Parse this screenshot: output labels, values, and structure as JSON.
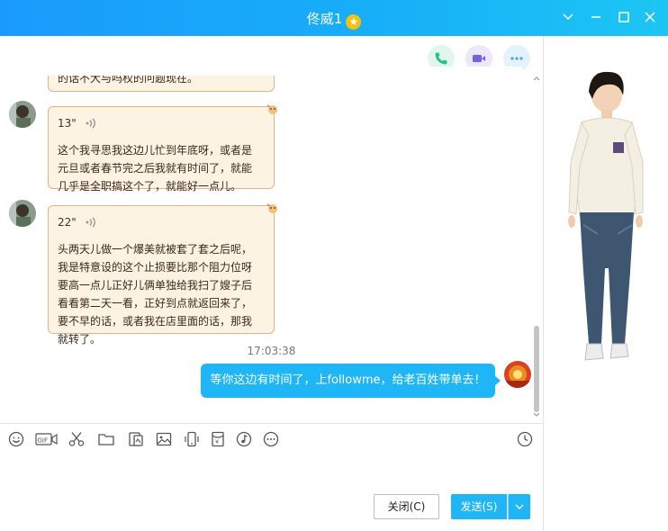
{
  "window": {
    "title": "佟威1",
    "title_badge": "★"
  },
  "chat": {
    "partial_message": "的话不大与吗权的问题现在。",
    "messages": [
      {
        "voice_duration": "13\"",
        "text": [
          "这个我寻思我这边儿忙到年底呀，或者是",
          "元旦或者春节完之后我就有时间了，就能",
          "几乎是全职搞这个了，就能好一点儿。"
        ]
      },
      {
        "voice_duration": "22\"",
        "text": [
          "头两天儿做一个爆美就被套了套之后呢，",
          "我是特意设的这个止损要比那个阻力位呀",
          "要高一点儿正好儿俩单独给我扫了嫂子后",
          "看看第二天一看，正好到点就返回来了，",
          "要不早的话，或者我在店里面的话，那我",
          "就转了。"
        ]
      }
    ],
    "timestamp": "17:03:38",
    "outgoing_message": "等你这边有时间了，上followme，给老百姓带单去！"
  },
  "buttons": {
    "close_label": "关闭(C)",
    "send_label": "发送(S)"
  },
  "colors": {
    "titlebar": "#1aa8fa",
    "accent": "#1eb6f6",
    "bubble_bg": "#fdf3e2",
    "bubble_border": "#d9b689",
    "phone_green": "#23c48b",
    "video_purple": "#7b5cf0",
    "more_blue": "#3da9f6"
  },
  "toolbar": [
    "emoji-icon",
    "gif-icon",
    "scissors-icon",
    "folder-icon",
    "sticker-icon",
    "image-icon",
    "phone-icon",
    "red-packet-icon",
    "music-icon",
    "more-icon",
    "history-clock-icon"
  ]
}
